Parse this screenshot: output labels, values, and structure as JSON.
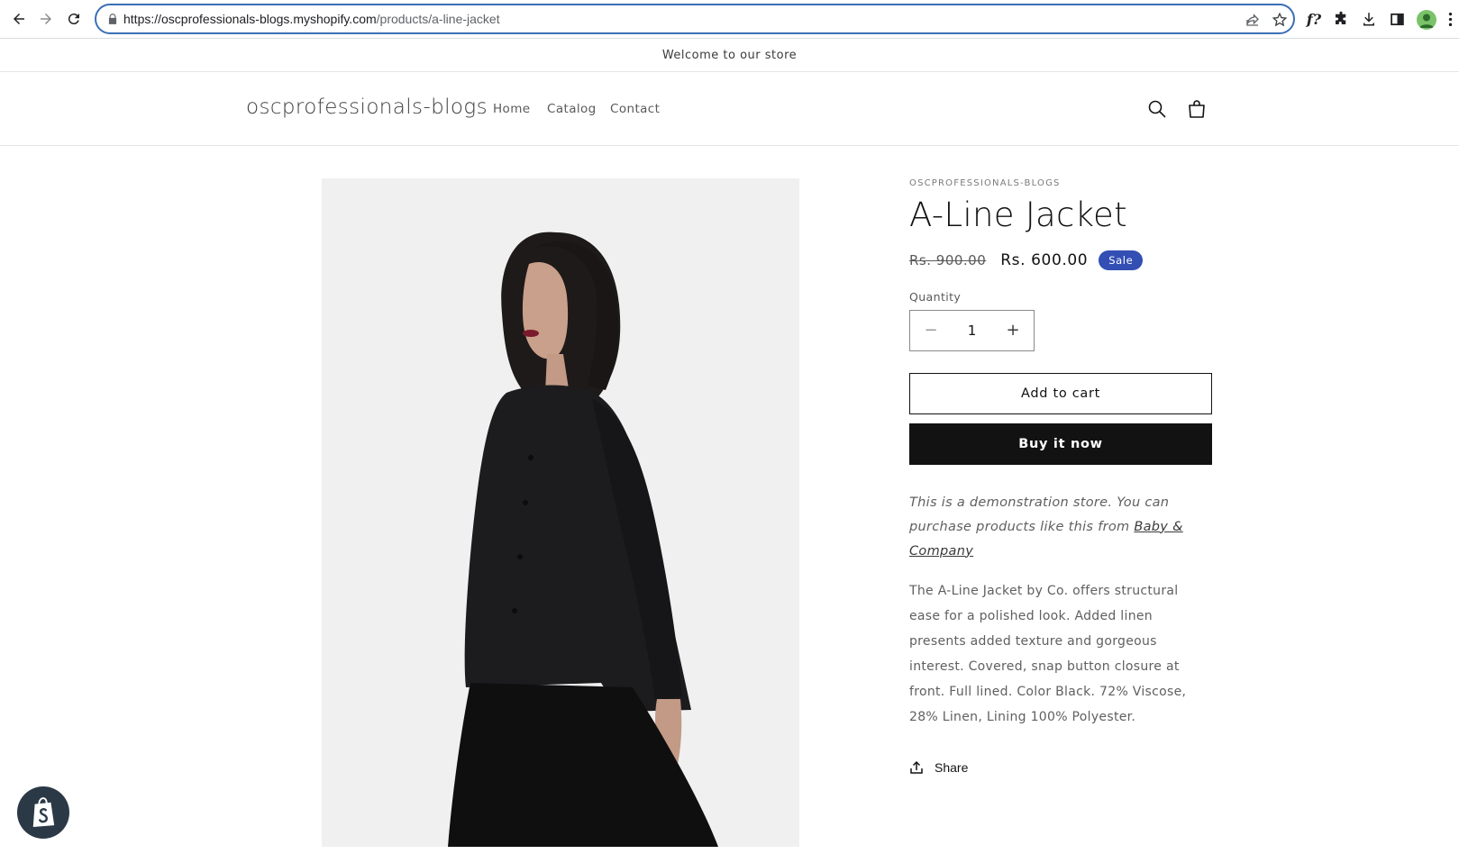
{
  "browser": {
    "url_host": "https://oscprofessionals-blogs.myshopify.com",
    "url_path": "/products/a-line-jacket",
    "ext_label": "f?"
  },
  "announcement": {
    "text": "Welcome to our store"
  },
  "header": {
    "logo": "oscprofessionals-blogs",
    "menu": [
      {
        "label": "Home"
      },
      {
        "label": "Catalog"
      },
      {
        "label": "Contact"
      }
    ]
  },
  "product": {
    "vendor": "OSCPROFESSIONALS-BLOGS",
    "title": "A-Line Jacket",
    "price_regular": "Rs. 900.00",
    "price_sale": "Rs. 600.00",
    "badge": "Sale",
    "quantity_label": "Quantity",
    "quantity_value": "1",
    "quantity_minus": "−",
    "quantity_plus": "+",
    "add_to_cart": "Add to cart",
    "buy_now": "Buy it now",
    "demo_text": "This is a demonstration store. You can purchase products like this from ",
    "demo_link": "Baby & Company",
    "description": "The A-Line Jacket by Co. offers structural ease for a polished look. Added linen presents added texture and gorgeous interest. Covered, snap button closure at front. Full lined. Color Black. 72% Viscose, 28% Linen, Lining 100% Polyester.",
    "share": "Share"
  },
  "colors": {
    "sale_badge": "#334fb4",
    "buy_button": "#121212",
    "omnibox_border": "#3a6fb5",
    "shopify_badge": "#2b3947"
  }
}
